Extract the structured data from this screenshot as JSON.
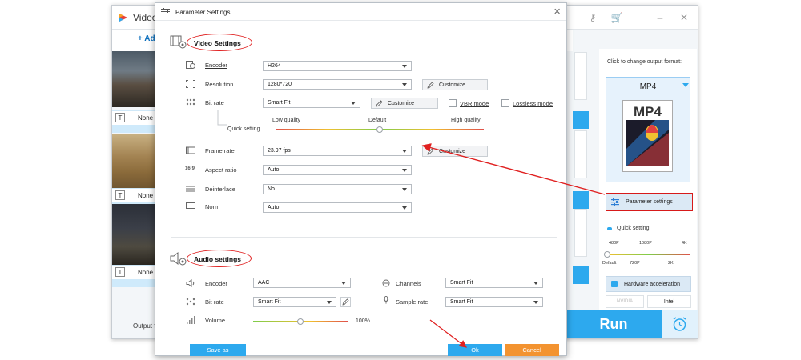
{
  "main_window": {
    "title": "Video",
    "add_label": "+ Ad",
    "thumb_rows": [
      {
        "label": "None"
      },
      {
        "label": "None"
      },
      {
        "label": "None"
      }
    ],
    "output_label": "Output f",
    "run_label": "Run"
  },
  "right_panel": {
    "header": "Click to change output format:",
    "format": "MP4",
    "format_box_text": "MP4",
    "param_settings_label": "Parameter settings",
    "quick_setting_label": "Quick setting",
    "quick_ticks_top": [
      "480P",
      "1080P",
      "4K"
    ],
    "quick_ticks_bottom": [
      "Default",
      "720P",
      "2K"
    ],
    "hw_label": "Hardware acceleration",
    "nvidia_label": "NVIDIA",
    "intel_label": "Intel"
  },
  "dialog": {
    "title": "Parameter Settings",
    "close_glyph": "✕",
    "video": {
      "section_title": "Video Settings",
      "encoder": {
        "label": "Encoder",
        "value": "H264"
      },
      "resolution": {
        "label": "Resolution",
        "value": "1280*720",
        "customize": "Customize"
      },
      "bitrate": {
        "label": "Bit rate",
        "value": "Smart Fit",
        "customize": "Customize",
        "vbr": "VBR mode",
        "lossless": "Lossless mode"
      },
      "quick_setting": {
        "label": "Quick setting",
        "low": "Low quality",
        "default": "Default",
        "high": "High quality",
        "level": 0.5
      },
      "framerate": {
        "label": "Frame rate",
        "value": "23.97 fps",
        "customize": "Customize"
      },
      "aspect": {
        "label": "Aspect ratio",
        "value": "Auto"
      },
      "deinterlace": {
        "label": "Deinterlace",
        "value": "No"
      },
      "norm": {
        "label": "Norm",
        "value": "Auto"
      }
    },
    "audio": {
      "section_title": "Audio settings",
      "encoder": {
        "label": "Encoder",
        "value": "AAC"
      },
      "channels": {
        "label": "Channels",
        "value": "Smart Fit"
      },
      "bitrate": {
        "label": "Bit rate",
        "value": "Smart Fit"
      },
      "sample_rate": {
        "label": "Sample rate",
        "value": "Smart Fit"
      },
      "volume": {
        "label": "Volume",
        "value": "100%",
        "level": 0.5
      }
    },
    "footer": {
      "save_as": "Save as",
      "ok": "Ok",
      "cancel": "Cancel"
    }
  },
  "colors": {
    "accent": "#2da9ee",
    "highlight_red": "#e02020",
    "cancel_orange": "#f39330"
  }
}
